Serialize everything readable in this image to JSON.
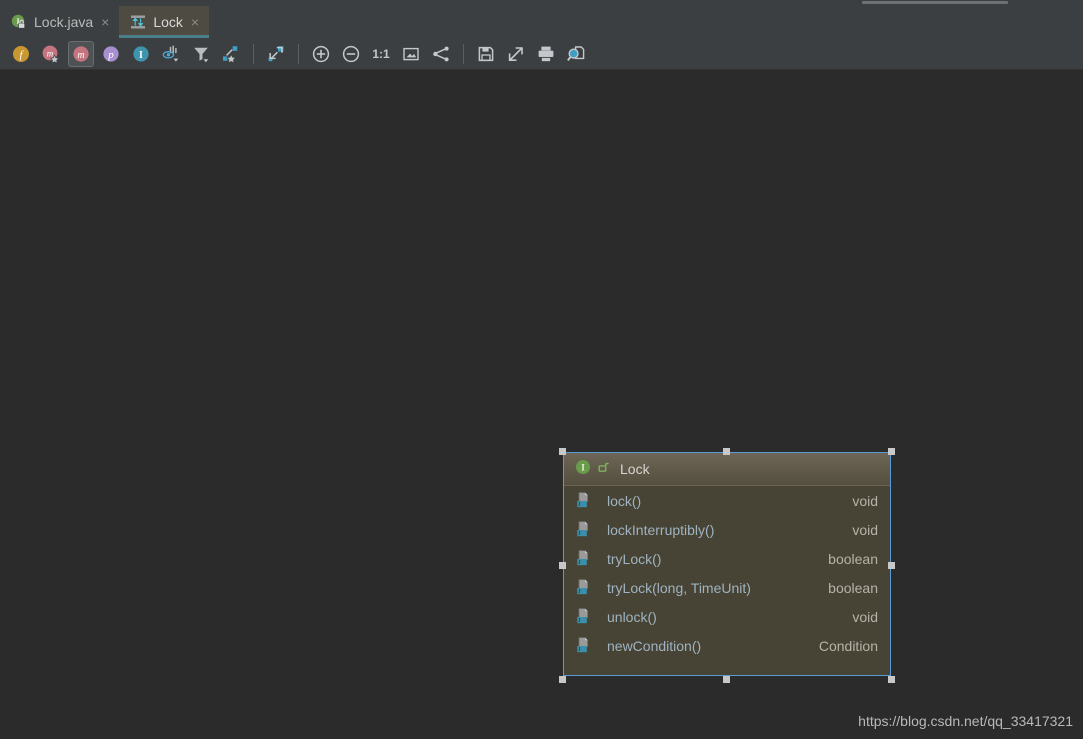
{
  "tabs": [
    {
      "label": "Lock.java",
      "icon": "java-interface-file-icon",
      "active": false,
      "close": "×"
    },
    {
      "label": "Lock",
      "icon": "uml-diagram-icon",
      "active": true,
      "close": "×"
    }
  ],
  "toolbar": {
    "groups": [
      {
        "buttons": [
          {
            "name": "show-fields-icon",
            "glyph": "f",
            "pressed": false
          },
          {
            "name": "show-constructors-icon",
            "glyph": "m",
            "pressed": false
          },
          {
            "name": "show-methods-icon",
            "glyph": "m",
            "pressed": true
          },
          {
            "name": "show-properties-icon",
            "glyph": "p",
            "pressed": false
          },
          {
            "name": "show-inner-classes-icon",
            "glyph": "I",
            "pressed": false
          },
          {
            "name": "change-visibility-level-icon",
            "glyph": "",
            "pressed": false
          },
          {
            "name": "filter-icon",
            "glyph": "",
            "pressed": false
          },
          {
            "name": "show-dependencies-icon",
            "glyph": "",
            "pressed": false
          }
        ]
      },
      {
        "buttons": [
          {
            "name": "expand-collapse-icon",
            "glyph": "",
            "pressed": false
          }
        ]
      },
      {
        "buttons": [
          {
            "name": "zoom-in-icon",
            "glyph": "",
            "pressed": false
          },
          {
            "name": "zoom-out-icon",
            "glyph": "",
            "pressed": false
          },
          {
            "name": "actual-size-icon",
            "glyph": "1:1",
            "pressed": false
          },
          {
            "name": "fit-content-icon",
            "glyph": "",
            "pressed": false
          },
          {
            "name": "apply-layout-icon",
            "glyph": "",
            "pressed": false
          }
        ]
      },
      {
        "buttons": [
          {
            "name": "save-icon",
            "glyph": "",
            "pressed": false
          },
          {
            "name": "export-icon",
            "glyph": "",
            "pressed": false
          },
          {
            "name": "print-icon",
            "glyph": "",
            "pressed": false
          },
          {
            "name": "print-preview-icon",
            "glyph": "",
            "pressed": false
          }
        ]
      }
    ]
  },
  "diagram": {
    "node": {
      "title": "Lock",
      "title_icon": "interface-icon",
      "lock_icon": "unlock-icon",
      "selected": true,
      "members": [
        {
          "icon": "java-method-icon",
          "name": "lock()",
          "type": "void"
        },
        {
          "icon": "java-method-icon",
          "name": "lockInterruptibly()",
          "type": "void"
        },
        {
          "icon": "java-method-icon",
          "name": "tryLock()",
          "type": "boolean"
        },
        {
          "icon": "java-method-icon",
          "name": "tryLock(long, TimeUnit)",
          "type": "boolean"
        },
        {
          "icon": "java-method-icon",
          "name": "unlock()",
          "type": "void"
        },
        {
          "icon": "java-method-icon",
          "name": "newCondition()",
          "type": "Condition"
        }
      ]
    }
  },
  "watermark": {
    "text": "https://blog.csdn.net/qq_33417321"
  },
  "colors": {
    "canvas_bg": "#2b2b2b",
    "chrome_bg": "#3c3f41",
    "active_tab_bg": "#4e4b42",
    "active_tab_underline": "#4b7f88",
    "node_body_bg": "#474335",
    "node_header_top": "#6d6657",
    "node_header_bottom": "#554f3f",
    "selection_border": "#5b9bd5",
    "selection_handle": "#c8c8c8",
    "member_name": "#9fb3c0",
    "member_type": "#b6b3a8",
    "interface_green": "#6a9b4b",
    "java_badge_blue": "#3c8fa8"
  }
}
